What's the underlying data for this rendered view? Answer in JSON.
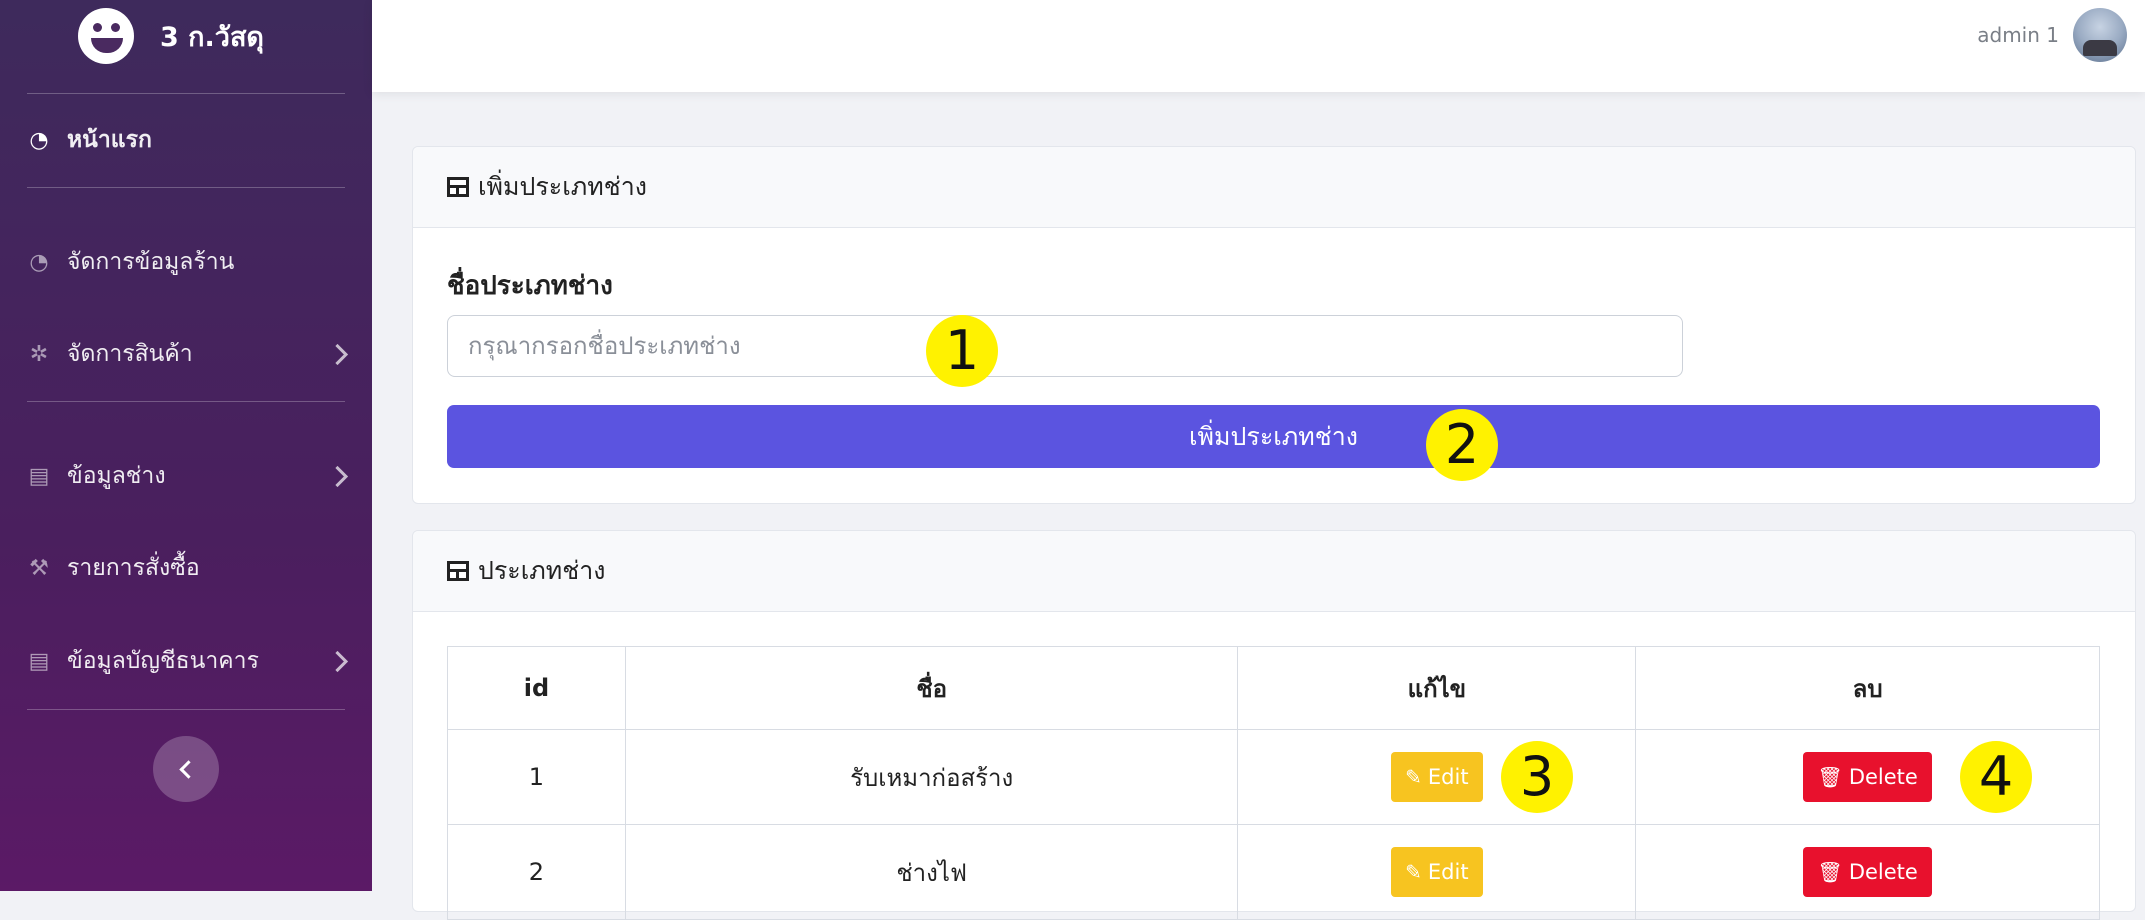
{
  "sidebar": {
    "brand": "3 ก.วัสดุ",
    "items": [
      {
        "label": "หน้าแรก"
      },
      {
        "label": "จัดการข้อมูลร้าน"
      },
      {
        "label": "จัดการสินค้า"
      },
      {
        "label": "ข้อมูลช่าง"
      },
      {
        "label": "รายการสั่งซื้อ"
      },
      {
        "label": "ข้อมูลบัญชีธนาคาร"
      }
    ]
  },
  "topbar": {
    "user_name": "admin 1"
  },
  "add_card": {
    "title": "เพิ่มประเภทช่าง",
    "field_label": "ชื่อประเภทช่าง",
    "field_placeholder": "กรุณากรอกชื่อประเภทช่าง",
    "field_value": "",
    "submit_label": "เพิ่มประเภทช่าง"
  },
  "list_card": {
    "title": "ประเภทช่าง",
    "columns": [
      "id",
      "ชื่อ",
      "แก้ไข",
      "ลบ"
    ],
    "rows": [
      {
        "id": "1",
        "name": "รับเหมาก่อสร้าง",
        "edit": "Edit",
        "delete": "Delete"
      },
      {
        "id": "2",
        "name": "ช่างไฟ",
        "edit": "Edit",
        "delete": "Delete"
      }
    ]
  },
  "markers": [
    "1",
    "2",
    "3",
    "4"
  ],
  "colors": {
    "sidebar": "#4a1f5e",
    "primary": "#5b54e0",
    "edit": "#f7c420",
    "delete": "#e8112d",
    "marker": "#fff200"
  }
}
